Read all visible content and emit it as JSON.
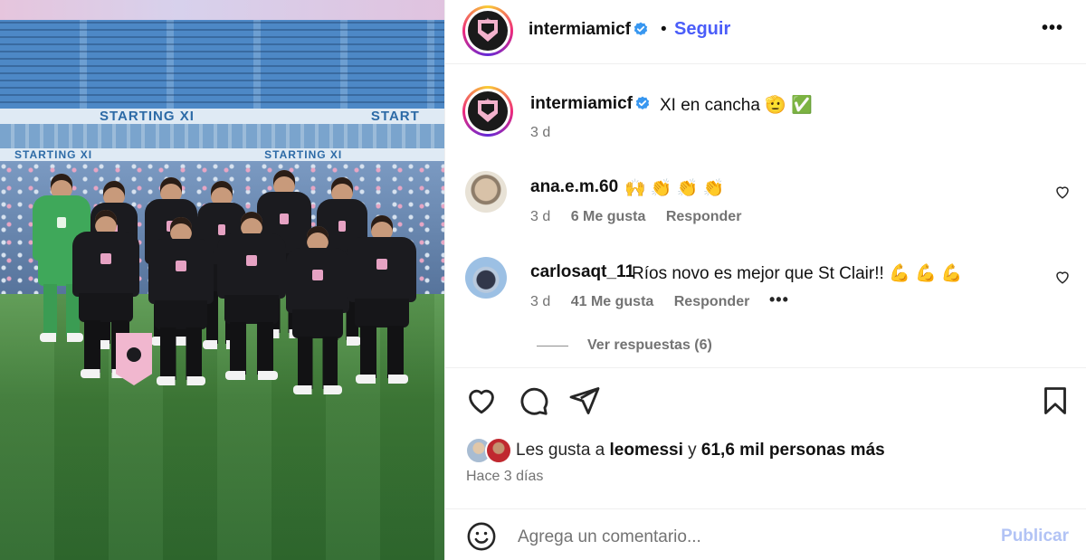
{
  "post": {
    "image": {
      "banner_text_top": "STARTING XI",
      "banner_text_top_right": "START",
      "banner_text_lower": "STARTING XI",
      "banner_text_lower_2": "STARTING XI"
    },
    "header": {
      "username": "intermiamicf",
      "separator": "•",
      "follow_label": "Seguir",
      "more_label": "•••"
    },
    "caption": {
      "username": "intermiamicf",
      "text": "XI en cancha 🫡 ✅",
      "time": "3 d"
    },
    "comments": [
      {
        "username": "ana.e.m.60",
        "text": "🙌 👏 👏 👏",
        "time": "3 d",
        "likes": "6 Me gusta",
        "reply_label": "Responder"
      },
      {
        "username": "carlosaqt_11",
        "text": "Ríos novo es mejor que St Clair!! 💪 💪 💪",
        "time": "3 d",
        "likes": "41 Me gusta",
        "reply_label": "Responder",
        "more_label": "•••"
      }
    ],
    "view_replies": "Ver respuestas (6)",
    "likes_prefix": "Les gusta a ",
    "likes_user": "leomessi",
    "likes_mid": " y ",
    "likes_count": "61,6 mil personas más",
    "time_ago": "Hace 3 días",
    "comment_box": {
      "placeholder": "Agrega un comentario...",
      "publish_label": "Publicar"
    },
    "icons": [
      "heart-icon",
      "comment-icon",
      "share-icon",
      "bookmark-icon",
      "emoji-icon",
      "verified-icon"
    ],
    "colors": {
      "accent": "#4a5df9",
      "publish_disabled": "#b2c3f5",
      "muted": "#737373",
      "verified": "#3897f0"
    }
  }
}
